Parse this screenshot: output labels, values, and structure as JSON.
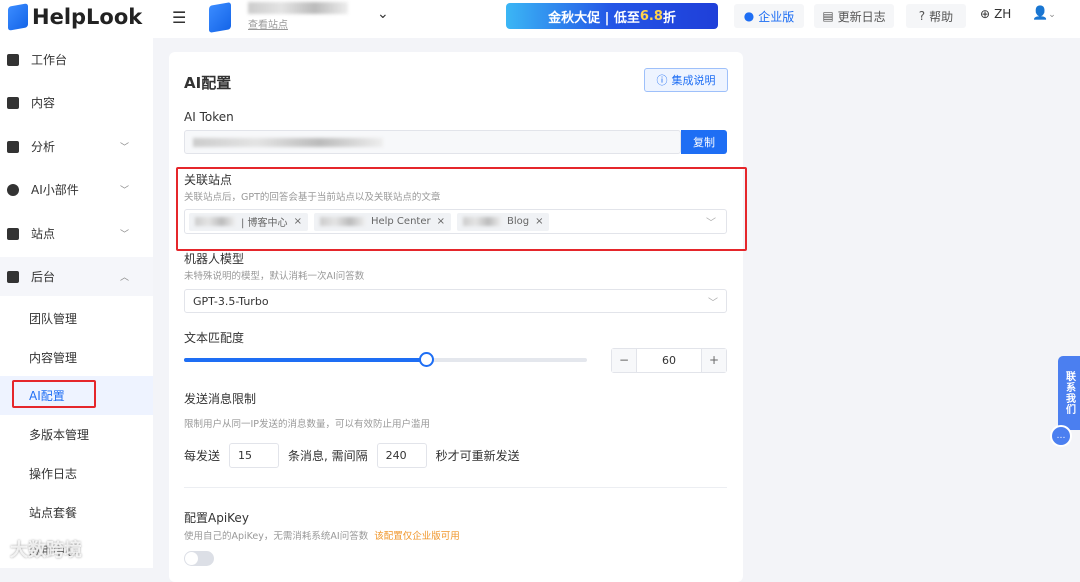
{
  "header": {
    "brand": "HelpLook",
    "site_link": "查看站点",
    "promo_prefix": "金秋大促 | 低至",
    "promo_highlight": "6.8",
    "promo_suffix": "折",
    "enterprise": "企业版",
    "changelog": "更新日志",
    "help": "帮助",
    "lang": "ZH"
  },
  "sidebar": {
    "items": [
      {
        "label": "工作台",
        "icon": "home-icon"
      },
      {
        "label": "内容",
        "icon": "book-icon"
      },
      {
        "label": "分析",
        "icon": "chart-icon"
      },
      {
        "label": "AI小部件",
        "icon": "widget-icon"
      },
      {
        "label": "站点",
        "icon": "monitor-icon"
      },
      {
        "label": "后台",
        "icon": "grid-icon"
      }
    ],
    "sub_items": [
      "团队管理",
      "内容管理",
      "AI配置",
      "多版本管理",
      "操作日志",
      "站点套餐",
      "应用中心"
    ],
    "active": "AI配置"
  },
  "main": {
    "title": "AI配置",
    "integration_button": "集成说明",
    "token": {
      "label": "AI Token",
      "copy": "复制"
    },
    "linked_sites": {
      "label": "关联站点",
      "desc": "关联站点后，GPT的回答会基于当前站点以及关联站点的文章",
      "tags": [
        "| 博客中心",
        "Help Center",
        "Blog"
      ]
    },
    "model": {
      "label": "机器人模型",
      "desc": "未特殊说明的模型，默认消耗一次AI问答数",
      "value": "GPT-3.5-Turbo"
    },
    "match": {
      "label": "文本匹配度",
      "value": "60",
      "percent": 60,
      "minus": "−",
      "plus": "+"
    },
    "rate_limit": {
      "label": "发送消息限制",
      "desc": "限制用户从同一IP发送的消息数量，可以有效防止用户滥用",
      "prefix": "每发送",
      "count": "15",
      "middle": "条消息, 需间隔",
      "seconds": "240",
      "suffix": "秒才可重新发送"
    },
    "apikey": {
      "label": "配置ApiKey",
      "desc": "使用自己的ApiKey，无需消耗系统AI问答数",
      "note": "该配置仅企业版可用",
      "enabled": false
    }
  },
  "contact": {
    "label": "联系我们"
  },
  "watermark": "大数跨境",
  "colors": {
    "primary": "#1e6ef4",
    "highlight": "#e5262b",
    "warn": "#f0962a"
  }
}
